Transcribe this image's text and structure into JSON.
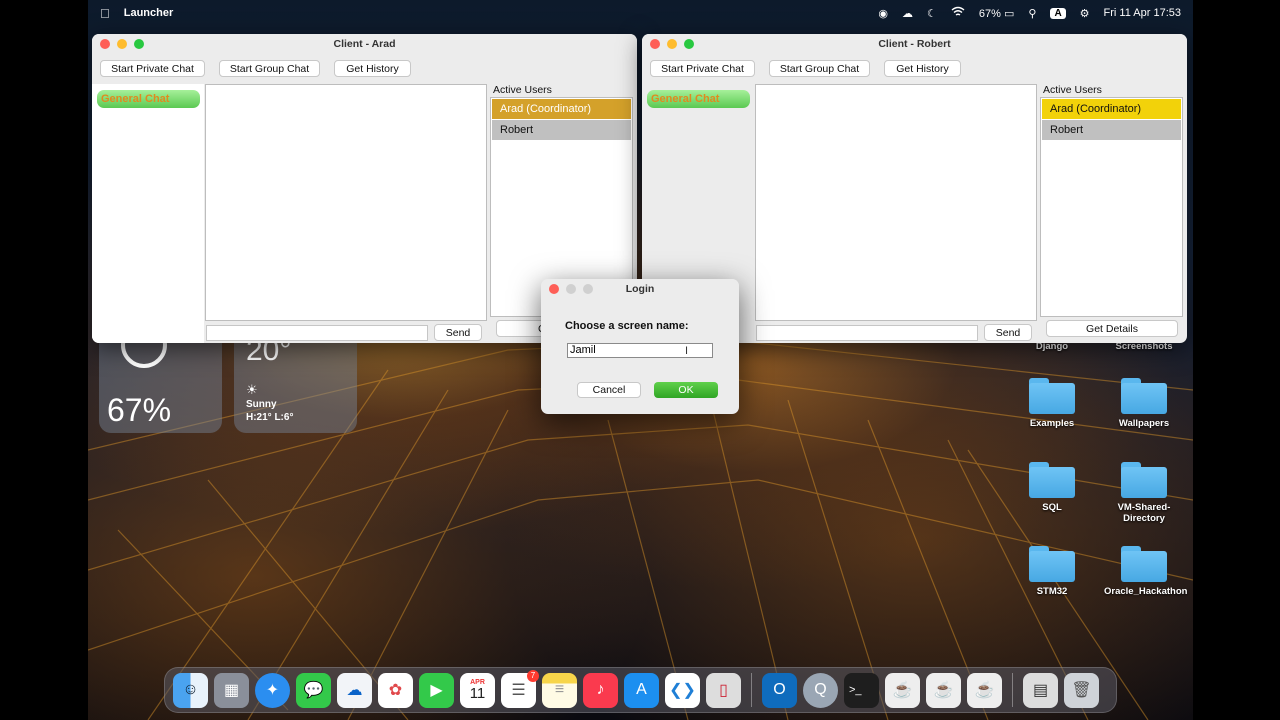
{
  "menubar": {
    "app_name": "Launcher",
    "battery": "67%",
    "input_source": "A",
    "datetime": "Fri 11 Apr  17:53"
  },
  "window_arad": {
    "title": "Client - Arad",
    "buttons": [
      "Start Private Chat",
      "Start Group Chat",
      "Get History"
    ],
    "chat_list": [
      "General Chat"
    ],
    "active_users_label": "Active Users",
    "users": [
      "Arad (Coordinator)",
      "Robert"
    ],
    "send_label": "Send",
    "details_partial": "G"
  },
  "window_robert": {
    "title": "Client - Robert",
    "buttons": [
      "Start Private Chat",
      "Start Group Chat",
      "Get History"
    ],
    "chat_list": [
      "General Chat"
    ],
    "active_users_label": "Active Users",
    "users": [
      "Arad (Coordinator)",
      "Robert"
    ],
    "send_label": "Send",
    "details_label": "Get Details"
  },
  "login": {
    "title": "Login",
    "prompt": "Choose a screen name:",
    "value": "Jamil",
    "cancel_label": "Cancel",
    "ok_label": "OK"
  },
  "widgets": {
    "battery_percent": "67%",
    "temperature": "20°",
    "condition": "Sunny",
    "hilo": "H:21° L:6°"
  },
  "desktop_icons": {
    "partial_top": [
      "Django",
      "Screenshots"
    ],
    "items": [
      "Examples",
      "Wallpapers",
      "SQL",
      "VM-Shared-Directory",
      "STM32",
      "Oracle_Hackathon"
    ]
  },
  "dock": {
    "calendar_month": "APR",
    "calendar_day": "11",
    "reminders_badge": "7"
  },
  "colors": {
    "coordinator_arad": "#d4a12a",
    "coordinator_robert": "#f2d20a",
    "user_row": "#c0c0c0",
    "general_chat_text": "#e08a1f",
    "ok_button": "#2fa524"
  }
}
